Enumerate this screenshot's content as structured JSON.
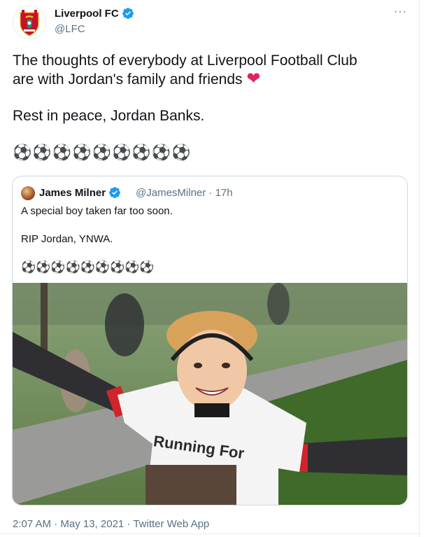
{
  "tweet": {
    "author_name": "Liverpool FC",
    "author_handle": "@LFC",
    "text_line1": "The thoughts of everybody at Liverpool Football Club",
    "text_line2": "are with Jordan's family and friends",
    "heart": "❤",
    "text_line3": "Rest in peace, Jordan Banks.",
    "balls": "⚽⚽⚽⚽⚽⚽⚽⚽⚽",
    "more": "···",
    "timestamp": "2:07 AM · May 13, 2021 · Twitter Web App"
  },
  "quoted_tweet": {
    "author_name": "James Milner",
    "author_handle": "@JamesMilner",
    "age": "· 17h",
    "line1": "A special boy taken far too soon.",
    "line2": "RIP Jordan, YNWA.",
    "balls": "⚽⚽⚽⚽⚽⚽⚽⚽⚽",
    "photo_shirt_text": "Running For"
  },
  "colors": {
    "verified": "#1d9bf0",
    "secondary_text": "#5b7083",
    "heart": "#e0245e",
    "lfc_red": "#c8102e"
  },
  "icons": [
    "lfc-crest-icon",
    "verified-icon",
    "more-icon"
  ]
}
